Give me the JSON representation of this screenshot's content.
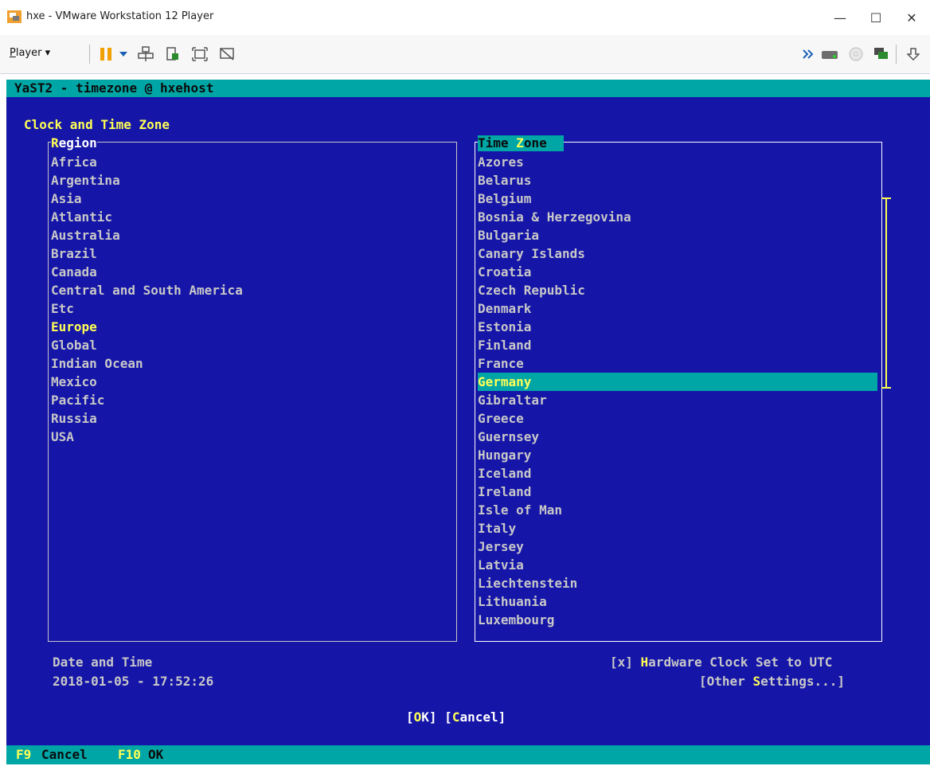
{
  "window": {
    "title": "hxe - VMware Workstation 12 Player",
    "minimize_glyph": "—",
    "maximize_glyph": "☐",
    "close_glyph": "✕"
  },
  "toolbar": {
    "player_menu_first": "P",
    "player_menu_rest": "layer",
    "player_menu_arrow": "▾",
    "icons": [
      "pause-icon",
      "dropdown-arrow-icon",
      "send-ctrl-alt-del-icon",
      "unity-icon",
      "fullscreen-icon",
      "no-display-icon",
      "more-icon",
      "hard-disk-icon",
      "cd-icon",
      "network-icon",
      "down-arrow-icon"
    ]
  },
  "console": {
    "top_title": "YaST2 - timezone @ hxehost",
    "colors": {
      "background": "#1515a8",
      "bar": "#00a6a6",
      "highlight": "#ffff55",
      "text": "#c8c8c8"
    },
    "clock_title": "Clock and Time Zone",
    "region": {
      "title": "Region",
      "selected": "Europe",
      "items": [
        "Africa",
        "Argentina",
        "Asia",
        "Atlantic",
        "Australia",
        "Brazil",
        "Canada",
        "Central and South America",
        "Etc",
        "Europe",
        "Global",
        "Indian Ocean",
        "Mexico",
        "Pacific",
        "Russia",
        "USA"
      ]
    },
    "timezone": {
      "title_pre": "Time ",
      "title_hot": "Z",
      "title_post": "one",
      "selected": "Germany",
      "items": [
        "Azores",
        "Belarus",
        "Belgium",
        "Bosnia & Herzegovina",
        "Bulgaria",
        "Canary Islands",
        "Croatia",
        "Czech Republic",
        "Denmark",
        "Estonia",
        "Finland",
        "France",
        "Germany",
        "Gibraltar",
        "Greece",
        "Guernsey",
        "Hungary",
        "Iceland",
        "Ireland",
        "Isle of Man",
        "Italy",
        "Jersey",
        "Latvia",
        "Liechtenstein",
        "Lithuania",
        "Luxembourg"
      ]
    },
    "date_label": "Date and Time",
    "date_value": "2018-01-05 - 17:52:26",
    "hwclock_box": "[x] ",
    "hwclock_hot": "H",
    "hwclock_rest": "ardware Clock Set to UTC",
    "other_pre": "[Other ",
    "other_hot": "S",
    "other_post": "ettings...]",
    "ok_open": "[",
    "ok_hot": "O",
    "ok_post": "K] [",
    "cancel_hot": "C",
    "cancel_post": "ancel]",
    "fkeys": [
      {
        "key": "F9",
        "label": "Cancel"
      },
      {
        "key": "F10",
        "label": "OK"
      }
    ]
  }
}
